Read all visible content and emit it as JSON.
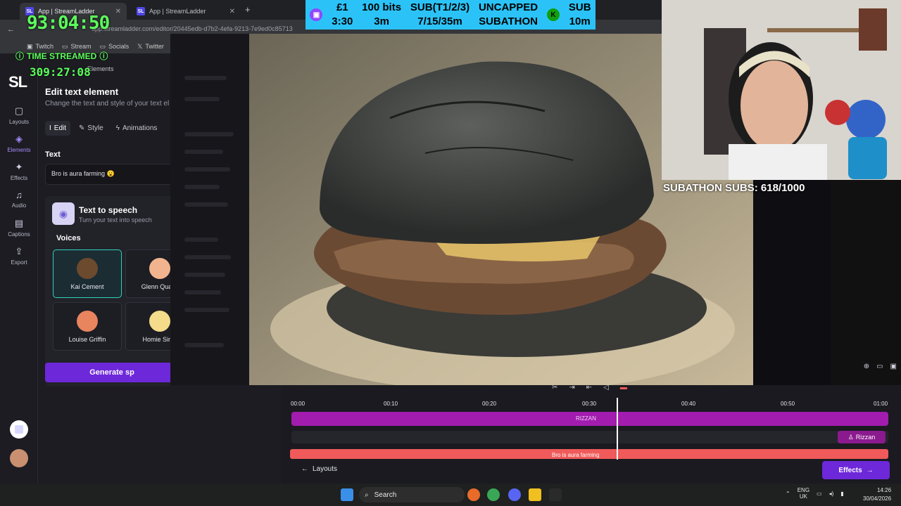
{
  "browser": {
    "tabs": [
      {
        "label": "App | StreamLadder"
      },
      {
        "label": "App | StreamLadder"
      }
    ],
    "url": "app.streamladder.com/editor/20445edb-d7b2-4efa-9213-7e9ed0c85713",
    "bookmarks": [
      "Twitch",
      "Stream",
      "Socials",
      "Twitter"
    ]
  },
  "overlay": {
    "timer": "93:04:50",
    "time_streamed_label": "TIME STREAMED",
    "time_streamed_value": "309:27:08",
    "banner": [
      {
        "top": "£1",
        "bottom": "3:30"
      },
      {
        "top": "100 bits",
        "bottom": "3m"
      },
      {
        "top": "SUB(T1/2/3)",
        "bottom": "7/15/35m"
      },
      {
        "top": "UNCAPPED",
        "bottom": "SUBATHON"
      },
      {
        "top": "SUB",
        "bottom": "10m"
      }
    ],
    "subathon_subs": "SUBATHON SUBS: 618/1000",
    "colors": {
      "timer": "#5cff5c",
      "banner": "#2bc3f7"
    }
  },
  "sidebar": {
    "logo": "SL",
    "items": [
      {
        "label": "Layouts",
        "icon": "square-icon"
      },
      {
        "label": "Elements",
        "icon": "shapes-icon"
      },
      {
        "label": "Effects",
        "icon": "sparkle-icon"
      },
      {
        "label": "Audio",
        "icon": "music-icon"
      },
      {
        "label": "Captions",
        "icon": "caption-icon"
      },
      {
        "label": "Export",
        "icon": "export-icon"
      }
    ]
  },
  "panel": {
    "breadcrumb": "Elements",
    "title": "Edit text element",
    "subtitle": "Change the text and style of your text el",
    "tabs": [
      "Edit",
      "Style",
      "Animations"
    ],
    "text_label": "Text",
    "text_value": "Bro is aura farming 😮",
    "tts_title": "Text to speech",
    "tts_subtitle": "Turn your text into speech",
    "voices_label": "Voices",
    "voices": [
      "Kai Cement",
      "Glenn Quack",
      "Louise Griffin",
      "Homie Simp"
    ],
    "generate_label": "Generate sp"
  },
  "timeline": {
    "ticks": [
      "00:00",
      "00:10",
      "00:20",
      "00:30",
      "00:40",
      "00:50",
      "01:00"
    ],
    "purple_track_label": "RIZZAN",
    "chip_label": "Rizzan",
    "red_track_label": "Bro is aura farming",
    "layouts_label": "Layouts",
    "effects_label": "Effects"
  },
  "taskbar": {
    "search": "Search",
    "lang_top": "ENG",
    "lang_bottom": "UK",
    "time": "14:26",
    "date": "30/04/2026"
  }
}
